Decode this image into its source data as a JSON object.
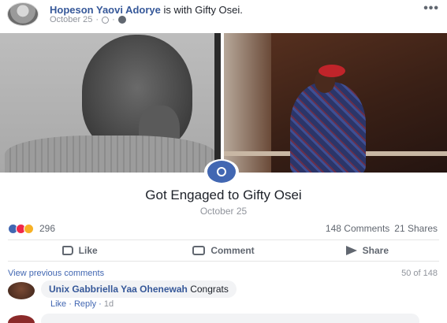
{
  "post": {
    "author": "Hopeson Yaovi Adorye",
    "with_text": " is with Gifty Osei.",
    "date": "October 25",
    "date_separator": "·",
    "more": "•••"
  },
  "life_event": {
    "title": "Got Engaged to Gifty Osei",
    "date": "October 25"
  },
  "stats": {
    "reactions": "296",
    "comments": "148 Comments",
    "shares": "21 Shares"
  },
  "actions": {
    "like": "Like",
    "comment": "Comment",
    "share": "Share"
  },
  "comments_section": {
    "view_previous": "View previous comments",
    "count": "50 of 148",
    "items": [
      {
        "author": "Unix Gabbriella Yaa Ohenewah",
        "text": " Congrats",
        "like": "Like",
        "reply": "Reply",
        "time": "1d"
      }
    ]
  },
  "icons": {
    "reactions": [
      "like-icon",
      "love-icon",
      "wow-icon"
    ],
    "engaged": "ring-icon"
  },
  "colors": {
    "link": "#365899",
    "accent": "#4267b2",
    "muted": "#90949c"
  }
}
